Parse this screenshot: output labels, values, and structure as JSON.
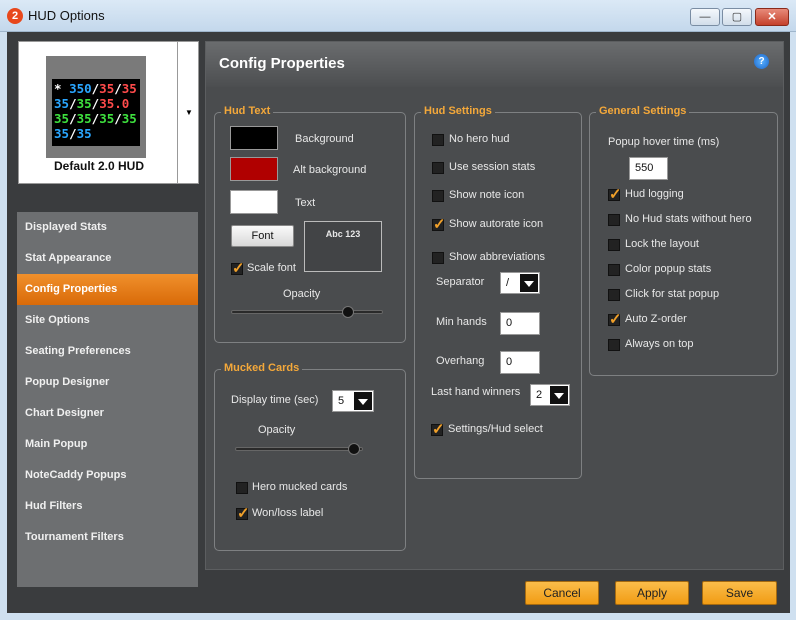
{
  "window": {
    "title": "HUD Options",
    "app_icon": "2",
    "min": "—",
    "max": "▢",
    "close": "✕"
  },
  "hud_preview": {
    "line1": [
      "*",
      "350",
      "/",
      "35",
      "/",
      "35"
    ],
    "line2": [
      "35",
      "/",
      "35",
      "/",
      "35.0"
    ],
    "line3": [
      "35",
      "/",
      "35",
      "/",
      "35",
      "/",
      "35"
    ],
    "line4": [
      "35",
      "/",
      "35"
    ],
    "name": "Default 2.0 HUD",
    "dropdown_arrow": "▼"
  },
  "nav": {
    "items": [
      {
        "label": "Displayed Stats"
      },
      {
        "label": "Stat Appearance"
      },
      {
        "label": "Config Properties"
      },
      {
        "label": "Site Options"
      },
      {
        "label": "Seating Preferences"
      },
      {
        "label": "Popup Designer"
      },
      {
        "label": "Chart Designer"
      },
      {
        "label": "Main Popup"
      },
      {
        "label": "NoteCaddy Popups"
      },
      {
        "label": "Hud Filters"
      },
      {
        "label": "Tournament Filters"
      }
    ],
    "active_index": 2
  },
  "main": {
    "title": "Config Properties",
    "help_icon": "?"
  },
  "hud_text": {
    "label": "Hud Text",
    "background_label": "Background",
    "alt_background_label": "Alt background",
    "text_label": "Text",
    "font_button": "Font",
    "sample": "Abc 123",
    "scale_font_label": "Scale font",
    "scale_font_checked": true,
    "opacity_label": "Opacity",
    "opacity_value": 0.77,
    "colors": {
      "background": "#000000",
      "alt_background": "#b00000",
      "text": "#ffffff"
    }
  },
  "mucked_cards": {
    "label": "Mucked Cards",
    "display_time_label": "Display time (sec)",
    "display_time_value": "5",
    "opacity_label": "Opacity",
    "opacity_value": 0.93,
    "hero_mucked_label": "Hero mucked cards",
    "hero_mucked_checked": false,
    "won_loss_label": "Won/loss label",
    "won_loss_checked": true
  },
  "hud_settings": {
    "label": "Hud Settings",
    "checkboxes": [
      {
        "label": "No hero hud",
        "checked": false
      },
      {
        "label": "Use session stats",
        "checked": false
      },
      {
        "label": "Show note icon",
        "checked": false
      },
      {
        "label": "Show autorate icon",
        "checked": true
      },
      {
        "label": "Show abbreviations",
        "checked": false
      }
    ],
    "separator_label": "Separator",
    "separator_value": "/",
    "min_hands_label": "Min hands",
    "min_hands_value": "0",
    "overhang_label": "Overhang",
    "overhang_value": "0",
    "last_hand_winners_label": "Last hand winners",
    "last_hand_winners_value": "2",
    "settings_hud_select_label": "Settings/Hud select",
    "settings_hud_select_checked": true
  },
  "general_settings": {
    "label": "General Settings",
    "popup_hover_label": "Popup hover time (ms)",
    "popup_hover_value": "550",
    "checkboxes": [
      {
        "label": "Hud logging",
        "checked": true
      },
      {
        "label": "No Hud stats without hero",
        "checked": false
      },
      {
        "label": "Lock the layout",
        "checked": false
      },
      {
        "label": "Color popup stats",
        "checked": false
      },
      {
        "label": "Click for stat popup",
        "checked": false
      },
      {
        "label": "Auto Z-order",
        "checked": true
      },
      {
        "label": "Always on top",
        "checked": false
      }
    ]
  },
  "footer": {
    "cancel": "Cancel",
    "apply": "Apply",
    "save": "Save"
  },
  "colors": {
    "accent": "#f4a83a",
    "active_nav": "#e27a12",
    "button": "#f6ab2c"
  }
}
